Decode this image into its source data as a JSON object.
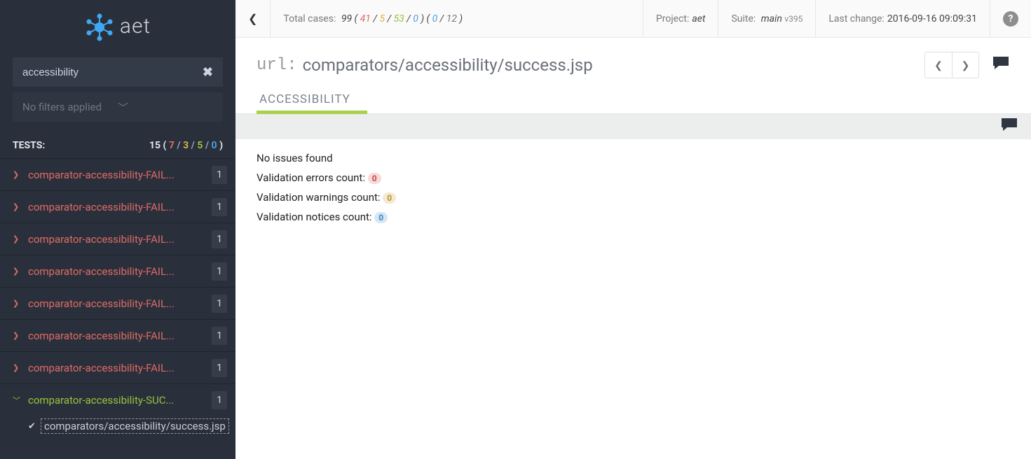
{
  "brand": "aet",
  "search": {
    "value": "accessibility"
  },
  "filters": {
    "label": "No filters applied"
  },
  "tests_header": {
    "label": "TESTS:",
    "total": "15",
    "fail": "7",
    "warn": "3",
    "pass": "5",
    "blue": "0"
  },
  "tests": [
    {
      "name": "comparator-accessibility-FAIL...",
      "status": "fail",
      "count": "1"
    },
    {
      "name": "comparator-accessibility-FAIL...",
      "status": "fail",
      "count": "1"
    },
    {
      "name": "comparator-accessibility-FAIL...",
      "status": "fail",
      "count": "1"
    },
    {
      "name": "comparator-accessibility-FAIL...",
      "status": "fail",
      "count": "1"
    },
    {
      "name": "comparator-accessibility-FAIL...",
      "status": "fail",
      "count": "1"
    },
    {
      "name": "comparator-accessibility-FAIL...",
      "status": "fail",
      "count": "1"
    },
    {
      "name": "comparator-accessibility-FAIL...",
      "status": "fail",
      "count": "1"
    },
    {
      "name": "comparator-accessibility-SUC...",
      "status": "pass",
      "count": "1",
      "expanded": true,
      "children": [
        {
          "name": "comparators/accessibility/success.jsp",
          "active": true
        }
      ]
    }
  ],
  "topbar": {
    "cases_label": "Total cases:",
    "cases_total": "99",
    "cases_fail": "41",
    "cases_warn": "5",
    "cases_pass": "53",
    "cases_blue": "0",
    "cases_p2a": "0",
    "cases_p2b": "12",
    "project_label": "Project:",
    "project_val": "aet",
    "suite_label": "Suite:",
    "suite_val": "main",
    "suite_ver": "v395",
    "last_label": "Last change:",
    "last_val": "2016-09-16 09:09:31"
  },
  "url": {
    "prefix": "url:",
    "value": "comparators/accessibility/success.jsp"
  },
  "tab": {
    "label": "ACCESSIBILITY"
  },
  "results": {
    "no_issues": "No issues found",
    "errors_label": "Validation errors count:",
    "errors_val": "0",
    "warnings_label": "Validation warnings count:",
    "warnings_val": "0",
    "notices_label": "Validation notices count:",
    "notices_val": "0"
  }
}
